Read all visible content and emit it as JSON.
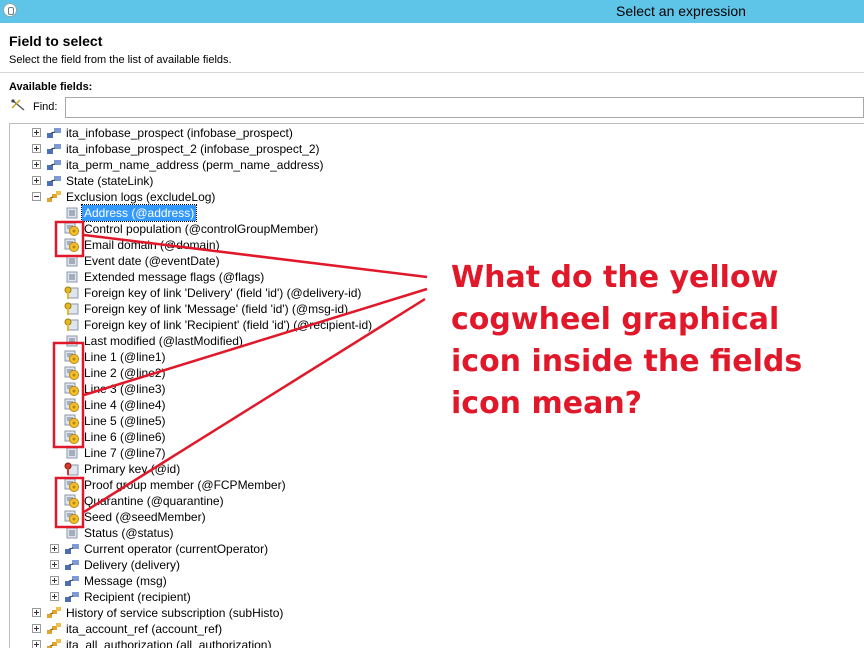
{
  "window": {
    "title": "Select an expression"
  },
  "header": {
    "title": "Field to select",
    "subtitle": "Select the field from the list of available fields."
  },
  "available_fields_label": "Available fields:",
  "find": {
    "label": "Find:",
    "value": ""
  },
  "tree": [
    {
      "label": "ita_infobase_prospect (infobase_prospect)",
      "expander": "plus",
      "icon": "link-icon",
      "level": 0
    },
    {
      "label": "ita_infobase_prospect_2 (infobase_prospect_2)",
      "expander": "plus",
      "icon": "link-icon",
      "level": 0
    },
    {
      "label": "ita_perm_name_address (perm_name_address)",
      "expander": "plus",
      "icon": "link-icon",
      "level": 0
    },
    {
      "label": "State (stateLink)",
      "expander": "plus",
      "icon": "link-icon",
      "level": 0
    },
    {
      "label": "Exclusion logs (excludeLog)",
      "expander": "minus",
      "icon": "collection-icon",
      "level": 0
    },
    {
      "label": "Address (@address)",
      "icon": "field-icon",
      "level": 1,
      "selected": true
    },
    {
      "label": "Control population (@controlGroupMember)",
      "icon": "field-cog-icon",
      "level": 1
    },
    {
      "label": "Email domain (@domain)",
      "icon": "field-cog-icon",
      "level": 1
    },
    {
      "label": "Event date (@eventDate)",
      "icon": "field-icon",
      "level": 1
    },
    {
      "label": "Extended message flags (@flags)",
      "icon": "field-icon",
      "level": 1
    },
    {
      "label": "Foreign key of link 'Delivery' (field 'id') (@delivery-id)",
      "icon": "key-icon",
      "level": 1
    },
    {
      "label": "Foreign key of link 'Message' (field 'id') (@msg-id)",
      "icon": "key-icon",
      "level": 1
    },
    {
      "label": "Foreign key of link 'Recipient' (field 'id') (@recipient-id)",
      "icon": "key-icon",
      "level": 1
    },
    {
      "label": "Last modified (@lastModified)",
      "icon": "field-icon",
      "level": 1
    },
    {
      "label": "Line 1 (@line1)",
      "icon": "field-cog-icon",
      "level": 1
    },
    {
      "label": "Line 2 (@line2)",
      "icon": "field-cog-icon",
      "level": 1
    },
    {
      "label": "Line 3 (@line3)",
      "icon": "field-cog-icon",
      "level": 1
    },
    {
      "label": "Line 4 (@line4)",
      "icon": "field-cog-icon",
      "level": 1
    },
    {
      "label": "Line 5 (@line5)",
      "icon": "field-cog-icon",
      "level": 1
    },
    {
      "label": "Line 6 (@line6)",
      "icon": "field-cog-icon",
      "level": 1
    },
    {
      "label": "Line 7 (@line7)",
      "icon": "field-icon",
      "level": 1
    },
    {
      "label": "Primary key (@id)",
      "icon": "primary-key-icon",
      "level": 1
    },
    {
      "label": "Proof group member (@FCPMember)",
      "icon": "field-cog-icon",
      "level": 1
    },
    {
      "label": "Quarantine (@quarantine)",
      "icon": "field-cog-icon",
      "level": 1
    },
    {
      "label": "Seed (@seedMember)",
      "icon": "field-cog-icon",
      "level": 1
    },
    {
      "label": "Status (@status)",
      "icon": "field-icon",
      "level": 1
    },
    {
      "label": "Current operator (currentOperator)",
      "expander": "plus",
      "icon": "link-icon",
      "level": 1
    },
    {
      "label": "Delivery (delivery)",
      "expander": "plus",
      "icon": "link-icon",
      "level": 1
    },
    {
      "label": "Message (msg)",
      "expander": "plus",
      "icon": "link-icon",
      "level": 1
    },
    {
      "label": "Recipient (recipient)",
      "expander": "plus",
      "icon": "link-icon",
      "level": 1
    },
    {
      "label": "History of service subscription (subHisto)",
      "expander": "plus",
      "icon": "collection-icon",
      "level": 0
    },
    {
      "label": "ita_account_ref (account_ref)",
      "expander": "plus",
      "icon": "collection-icon",
      "level": 0
    },
    {
      "label": "ita_all_authorization (all_authorization)",
      "expander": "plus",
      "icon": "collection-icon",
      "level": 0
    }
  ],
  "annotation": {
    "question": "What do the yellow cogwheel graphical icon inside the fields icon mean?",
    "color": "#e0182a"
  }
}
